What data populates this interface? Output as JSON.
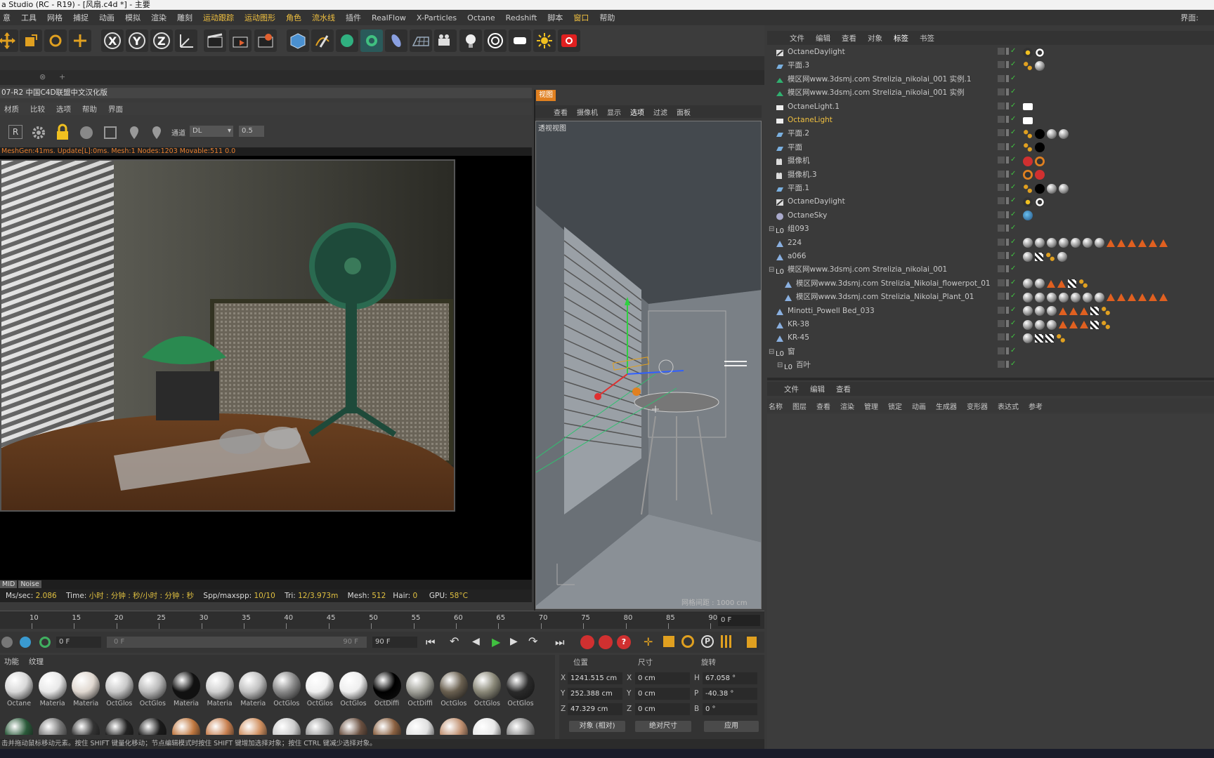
{
  "window": {
    "title": "a Studio (RC - R19) - [风扇.c4d *] - 主要"
  },
  "menu": {
    "items": [
      "意",
      "工具",
      "网格",
      "捕捉",
      "动画",
      "模拟",
      "渲染",
      "雕刻",
      "运动跟踪",
      "运动图形",
      "角色",
      "流水线",
      "插件",
      "RealFlow",
      "X-Particles",
      "Octane",
      "Redshift",
      "脚本",
      "窗口",
      "帮助"
    ],
    "right_label": "界面:"
  },
  "live_viewer": {
    "title": "07-R2 中国C4D联盟中文汉化版",
    "menu": [
      "材质",
      "比较",
      "选项",
      "帮助",
      "界面"
    ],
    "channel_label": "通道",
    "channel_value": "DL",
    "ratio_value": "0.5",
    "info_line": "MeshGen:41ms. Update[L]:0ms. Mesh:1 Nodes:1203 Movable:511  0.0",
    "foot_buttons": [
      "MID",
      "Noise"
    ],
    "status": {
      "mssec_label": "Ms/sec:",
      "mssec": "2.086",
      "time_label": "Time:",
      "time": "小时 : 分钟 : 秒/小时 : 分钟 : 秒",
      "spp_label": "Spp/maxspp:",
      "spp": "10/10",
      "tri_label": "Tri:",
      "tri": "12/3.973m",
      "mesh_label": "Mesh:",
      "mesh": "512",
      "hair_label": "Hair:",
      "hair": "0",
      "gpu_label": "GPU:",
      "gpu": "58°C"
    },
    "accent": "#e0c040"
  },
  "viewport": {
    "tab": "视图",
    "menu": [
      "查看",
      "摄像机",
      "显示",
      "选项",
      "过滤",
      "面板"
    ],
    "label": "透视视图",
    "grid_text": "网格间距 : 1000 cm"
  },
  "timeline": {
    "ticks": [
      "10",
      "15",
      "20",
      "25",
      "30",
      "35",
      "40",
      "45",
      "50",
      "55",
      "60",
      "65",
      "70",
      "75",
      "80",
      "85",
      "90"
    ],
    "frame_field": "0 F"
  },
  "playback": {
    "start": "0 F",
    "range_start": "0 F",
    "range_end": "90 F",
    "end": "90 F"
  },
  "materials": {
    "tabs": [
      "功能",
      "纹理"
    ],
    "row1": [
      {
        "label": "Octane",
        "color": "#d8d8d8"
      },
      {
        "label": "Materia",
        "color": "#e8e8e8"
      },
      {
        "label": "Materia",
        "color": "#e0d8d0"
      },
      {
        "label": "OctGlos",
        "color": "#c8c8c8"
      },
      {
        "label": "OctGlos",
        "color": "#b8b8b8"
      },
      {
        "label": "Materia",
        "color": "#111111"
      },
      {
        "label": "Materia",
        "color": "#d0d0d0"
      },
      {
        "label": "Materia",
        "color": "#c0c0c0"
      },
      {
        "label": "OctGlos",
        "color": "#888888"
      },
      {
        "label": "OctGlos",
        "color": "#f0f0f0"
      },
      {
        "label": "OctGlos",
        "color": "#eeeeee"
      },
      {
        "label": "OctDiffi",
        "color": "#000000"
      },
      {
        "label": "OctDiffi",
        "color": "#a0a098"
      },
      {
        "label": "OctGlos",
        "color": "#6a6050"
      },
      {
        "label": "OctGlos",
        "color": "#8a8878"
      },
      {
        "label": "OctGlos",
        "color": "#2a2a2a"
      }
    ],
    "row2_colors": [
      "#2a5a3a",
      "#777777",
      "#333333",
      "#222222",
      "#1a1a1a",
      "#c07840",
      "#c88050",
      "#d09060",
      "#cccccc",
      "#999999",
      "#6a5040",
      "#8a6040",
      "#e0e0e0",
      "#c09070",
      "#e8e8e8",
      "#888888"
    ]
  },
  "coordinates": {
    "headers": [
      "位置",
      "尺寸",
      "旋转"
    ],
    "pos": {
      "x": "1241.515 cm",
      "y": "252.388 cm",
      "z": "47.329 cm"
    },
    "size": {
      "x": "0 cm",
      "y": "0 cm",
      "z": "0 cm"
    },
    "rot": {
      "h": "67.058 °",
      "p": "-40.38 °",
      "b": "0 °"
    },
    "axis": {
      "x": "X",
      "y": "Y",
      "z": "Z",
      "h": "H",
      "p": "P",
      "b": "B"
    },
    "mode_select": "对象 (相对)",
    "size_select": "绝对尺寸",
    "apply_label": "应用"
  },
  "status_bar": "击并拖动鼠标移动元素。按住 SHIFT 键量化移动；节点编辑模式时按住 SHIFT 键增加选择对象；按住 CTRL 键减少选择对象。",
  "object_manager": {
    "menu": [
      "文件",
      "编辑",
      "查看",
      "对象",
      "标签",
      "书签"
    ],
    "rows": [
      {
        "name": "OctaneDaylight",
        "indent": 0,
        "icon": "sun",
        "tags": [
          "sun",
          "circle"
        ]
      },
      {
        "name": "平面.3",
        "indent": 0,
        "icon": "plane",
        "tags": [
          "dots",
          "ball"
        ]
      },
      {
        "name": "模区网www.3dsmj.com   Strelizia_nikolai_001 实例.1",
        "indent": 0,
        "icon": "inst",
        "tags": []
      },
      {
        "name": "模区网www.3dsmj.com   Strelizia_nikolai_001 实例",
        "indent": 0,
        "icon": "inst",
        "tags": []
      },
      {
        "name": "OctaneLight.1",
        "indent": 0,
        "icon": "light",
        "tags": [
          "white"
        ]
      },
      {
        "name": "OctaneLight",
        "indent": 0,
        "icon": "light",
        "tags": [
          "white"
        ],
        "highlight": true
      },
      {
        "name": "平面.2",
        "indent": 0,
        "icon": "plane",
        "tags": [
          "dots",
          "black",
          "ball",
          "ball"
        ]
      },
      {
        "name": "平面",
        "indent": 0,
        "icon": "plane",
        "tags": [
          "dots",
          "black"
        ]
      },
      {
        "name": "摄像机",
        "indent": 0,
        "icon": "cam",
        "tags": [
          "cam",
          "slash"
        ]
      },
      {
        "name": "摄像机.3",
        "indent": 0,
        "icon": "cam",
        "tags": [
          "slash",
          "cam"
        ]
      },
      {
        "name": "平面.1",
        "indent": 0,
        "icon": "plane",
        "tags": [
          "dots",
          "black",
          "ball",
          "ball"
        ]
      },
      {
        "name": "OctaneDaylight",
        "indent": 0,
        "icon": "sun",
        "tags": [
          "sun",
          "circle"
        ]
      },
      {
        "name": "OctaneSky",
        "indent": 0,
        "icon": "sky",
        "tags": [
          "blue"
        ]
      },
      {
        "name": "组093",
        "indent": 0,
        "icon": "null",
        "tags": []
      },
      {
        "name": "224",
        "indent": 0,
        "icon": "poly",
        "tags": [
          "ball",
          "ball",
          "ball",
          "ball",
          "ball",
          "ball",
          "ball",
          "tri",
          "tri",
          "tri",
          "tri",
          "tri",
          "tri"
        ]
      },
      {
        "name": "a066",
        "indent": 0,
        "icon": "poly",
        "tags": [
          "ball",
          "chk",
          "dots",
          "ball"
        ]
      },
      {
        "name": "模区网www.3dsmj.com   Strelizia_nikolai_001",
        "indent": 0,
        "icon": "null",
        "tags": []
      },
      {
        "name": "模区网www.3dsmj.com   Strelizia_Nikolai_flowerpot_01",
        "indent": 1,
        "icon": "poly",
        "tags": [
          "ball",
          "ball",
          "tri",
          "tri",
          "chk",
          "dots"
        ]
      },
      {
        "name": "模区网www.3dsmj.com   Strelizia_Nikolai_Plant_01",
        "indent": 1,
        "icon": "poly",
        "tags": [
          "ball",
          "ball",
          "ball",
          "ball",
          "ball",
          "ball",
          "ball",
          "tri",
          "tri",
          "tri",
          "tri",
          "tri",
          "tri"
        ]
      },
      {
        "name": "Minotti_Powell Bed_033",
        "indent": 0,
        "icon": "poly",
        "tags": [
          "ball",
          "ball",
          "ball",
          "tri",
          "tri",
          "tri",
          "chk",
          "dots"
        ]
      },
      {
        "name": "KR-38",
        "indent": 0,
        "icon": "poly",
        "tags": [
          "ball",
          "ball",
          "ball",
          "tri",
          "tri",
          "tri",
          "chk",
          "dots"
        ]
      },
      {
        "name": "KR-45",
        "indent": 0,
        "icon": "poly",
        "tags": [
          "ball",
          "chk",
          "chk",
          "dots"
        ]
      },
      {
        "name": "窗",
        "indent": 0,
        "icon": "null",
        "tags": []
      },
      {
        "name": "百叶",
        "indent": 1,
        "icon": "null",
        "tags": []
      }
    ]
  },
  "attr_manager": {
    "menu": [
      "文件",
      "编辑",
      "查看"
    ],
    "tabs": [
      "名称",
      "图层",
      "查看",
      "渲染",
      "管理",
      "锁定",
      "动画",
      "生成器",
      "变形器",
      "表达式",
      "参考"
    ]
  }
}
